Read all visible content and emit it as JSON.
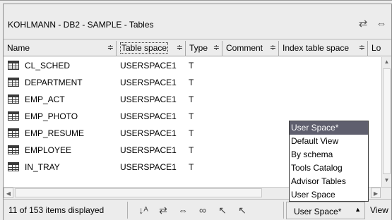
{
  "window": {
    "title": "KOHLMANN - DB2 - SAMPLE - Tables"
  },
  "columns": [
    {
      "label": "Name",
      "sort": "≑"
    },
    {
      "label": "Table space",
      "sort": "≑"
    },
    {
      "label": "Type",
      "sort": "≑"
    },
    {
      "label": "Comment",
      "sort": "≑"
    },
    {
      "label": "Index table space",
      "sort": "≑"
    },
    {
      "label": "Lo",
      "sort": ""
    }
  ],
  "rows": [
    {
      "name": "CL_SCHED",
      "tablespace": "USERSPACE1",
      "type": "T"
    },
    {
      "name": "DEPARTMENT",
      "tablespace": "USERSPACE1",
      "type": "T"
    },
    {
      "name": "EMP_ACT",
      "tablespace": "USERSPACE1",
      "type": "T"
    },
    {
      "name": "EMP_PHOTO",
      "tablespace": "USERSPACE1",
      "type": "T"
    },
    {
      "name": "EMP_RESUME",
      "tablespace": "USERSPACE1",
      "type": "T"
    },
    {
      "name": "EMPLOYEE",
      "tablespace": "USERSPACE1",
      "type": "T"
    },
    {
      "name": "IN_TRAY",
      "tablespace": "USERSPACE1",
      "type": "T"
    }
  ],
  "status": {
    "items_displayed": "11 of 153 items displayed"
  },
  "view_select": {
    "value": "User Space*",
    "view_label": "View"
  },
  "view_options": [
    "User Space*",
    "Default View",
    "By schema",
    "Tools Catalog",
    "Advisor Tables",
    "User Space"
  ],
  "icons": {
    "title_filter": "columns-filter-icon",
    "title_customize": "customize-columns-icon",
    "sort": "sort-az-icon",
    "filter": "filter-icon",
    "customize_columns": "customize-columns-icon",
    "find": "find-binoculars-icon",
    "select_all": "select-all-icon",
    "deselect_all": "deselect-all-icon"
  }
}
